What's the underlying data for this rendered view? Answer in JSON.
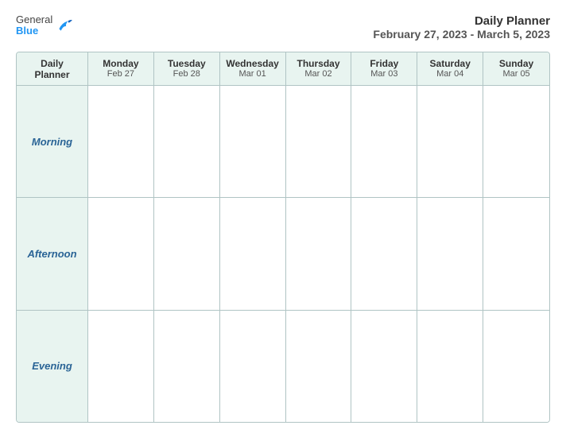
{
  "logo": {
    "general": "General",
    "blue": "Blue"
  },
  "header": {
    "title": "Daily Planner",
    "subtitle": "February 27, 2023 - March 5, 2023"
  },
  "calendar": {
    "planner_label_line1": "Daily",
    "planner_label_line2": "Planner",
    "days": [
      {
        "name": "Monday",
        "date": "Feb 27"
      },
      {
        "name": "Tuesday",
        "date": "Feb 28"
      },
      {
        "name": "Wednesday",
        "date": "Mar 01"
      },
      {
        "name": "Thursday",
        "date": "Mar 02"
      },
      {
        "name": "Friday",
        "date": "Mar 03"
      },
      {
        "name": "Saturday",
        "date": "Mar 04"
      },
      {
        "name": "Sunday",
        "date": "Mar 05"
      }
    ],
    "rows": [
      {
        "label": "Morning"
      },
      {
        "label": "Afternoon"
      },
      {
        "label": "Evening"
      }
    ]
  }
}
